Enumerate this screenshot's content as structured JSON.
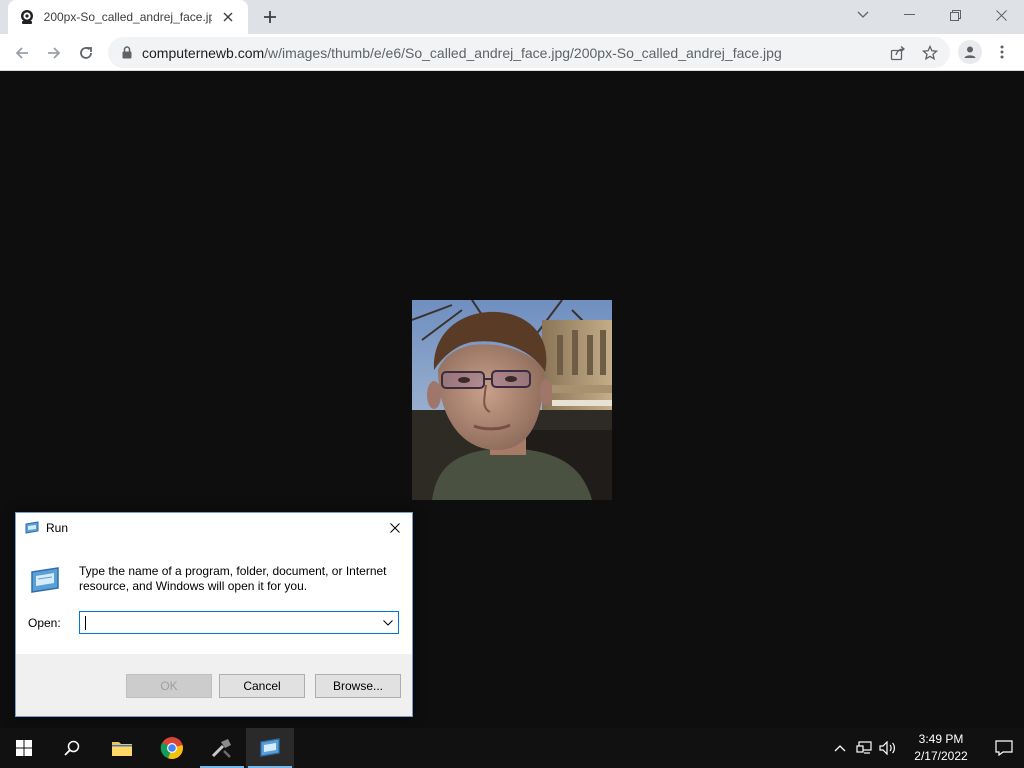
{
  "browser": {
    "tab": {
      "title": "200px-So_called_andrej_face.jpg",
      "favicon": "wikihow-style-favicon",
      "close_icon": "close-icon"
    },
    "new_tab_icon": "plus-icon",
    "window_controls": [
      "minimize-icon",
      "restore-icon",
      "close-icon"
    ],
    "url": {
      "domain": "computernewb.com",
      "path": "/w/images/thumb/e/e6/So_called_andrej_face.jpg/200px-So_called_andrej_face.jpg"
    }
  },
  "page": {
    "image_alt": "200px-So_called_andrej_face.jpg",
    "background": "#0e0e0e"
  },
  "run_dialog": {
    "title": "Run",
    "description": "Type the name of a program, folder, document, or Internet resource, and Windows will open it for you.",
    "open_label": "Open:",
    "input_value": "",
    "ok_label": "OK",
    "cancel_label": "Cancel",
    "browse_label": "Browse..."
  },
  "taskbar": {
    "items": [
      "start-icon",
      "search-icon",
      "file-explorer-icon",
      "chrome-icon",
      "tool-icon",
      "run-icon"
    ],
    "clock_time": "3:49 PM",
    "clock_date": "2/17/2022",
    "accent": "#76b9ed"
  }
}
